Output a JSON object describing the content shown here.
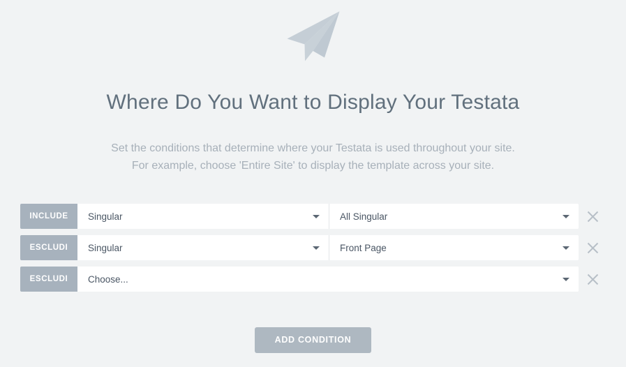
{
  "hero": {
    "icon": "paper-plane-icon",
    "color": "#c5ced6"
  },
  "heading": {
    "title": "Where Do You Want to Display Your Testata",
    "subtitle_line_1": "Set the conditions that determine where your Testata is used throughout your site.",
    "subtitle_line_2": "For example, choose 'Entire Site' to display the template across your site."
  },
  "conditions": {
    "remove_icon": "close-icon",
    "caret_icon": "chevron-down-icon",
    "rows": [
      {
        "type_label": "INCLUDE",
        "param_value": "Singular",
        "value_value": "All Singular",
        "layout": "split"
      },
      {
        "type_label": "ESCLUDI",
        "param_value": "Singular",
        "value_value": "Front Page",
        "layout": "split"
      },
      {
        "type_label": "ESCLUDI",
        "param_value": "Choose...",
        "value_value": "",
        "layout": "full"
      }
    ]
  },
  "footer": {
    "add_condition_label": "ADD CONDITION"
  },
  "colors": {
    "page_background": "#f1f3f4",
    "chip_gray": "#a7b2bd",
    "title_gray": "#61707d",
    "subtitle_gray": "#a7b0b9",
    "button_gray": "#aeb8c1",
    "field_text": "#4a5664"
  }
}
